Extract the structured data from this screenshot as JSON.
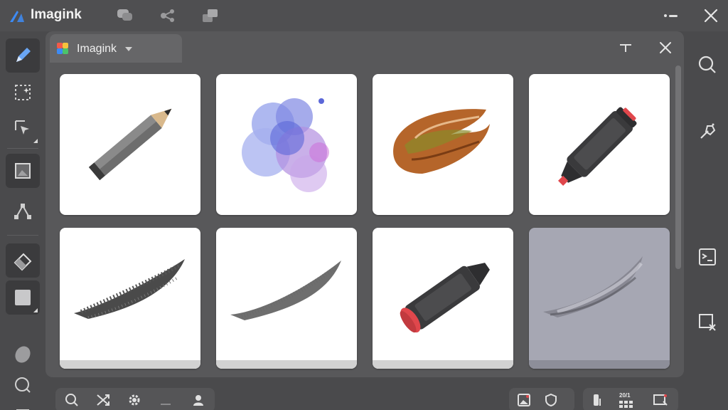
{
  "app": {
    "title": "Imagink",
    "accent": "#3d8bf5"
  },
  "titlebar": {
    "icons": [
      "chat-bubbles-icon",
      "node-graph-icon",
      "layers-icon"
    ],
    "right_icons": [
      "more-icon",
      "close-icon"
    ]
  },
  "left_toolbar": {
    "tools": [
      "pencil-tool-icon",
      "selection-sparkle-icon",
      "transform-icon",
      "frame-tool-icon",
      "vector-node-icon",
      "eraser-icon",
      "color-swatch-icon",
      "blob-brush-icon",
      "lasso-icon",
      "menu-icon"
    ]
  },
  "panel": {
    "tab_title": "Imagink",
    "brushes": [
      {
        "name": "pencil",
        "icon": "pencil-brush-icon"
      },
      {
        "name": "watercolor",
        "icon": "watercolor-brush-icon"
      },
      {
        "name": "oil",
        "icon": "oil-paint-brush-icon"
      },
      {
        "name": "marker",
        "icon": "marker-brush-icon"
      },
      {
        "name": "charcoal",
        "icon": "charcoal-brush-icon"
      },
      {
        "name": "soft-charcoal",
        "icon": "soft-charcoal-brush-icon"
      },
      {
        "name": "marker-2",
        "icon": "marker-brush-icon"
      },
      {
        "name": "airbrush",
        "icon": "airbrush-brush-icon"
      }
    ],
    "selected_index": 7,
    "colors": {
      "watercolor": "#8a6fd6",
      "oil": "#b5652a",
      "marker_tip": "#e0474c",
      "card_selected": "#a6a7b3"
    }
  },
  "right_sidebar": {
    "icons": [
      "search-icon",
      "magic-brush-icon",
      "adjust-icon",
      "crop-remove-icon"
    ]
  },
  "bottom_bar": {
    "left_icons": [
      "search-icon",
      "shuffle-icon",
      "gear-icon",
      "flat-icon",
      "user-icon"
    ],
    "right_icons": [
      "image-icon",
      "shield-icon",
      "touch-icon",
      "grid-count-icon",
      "close-frame-icon"
    ],
    "count_label": "20/1"
  }
}
